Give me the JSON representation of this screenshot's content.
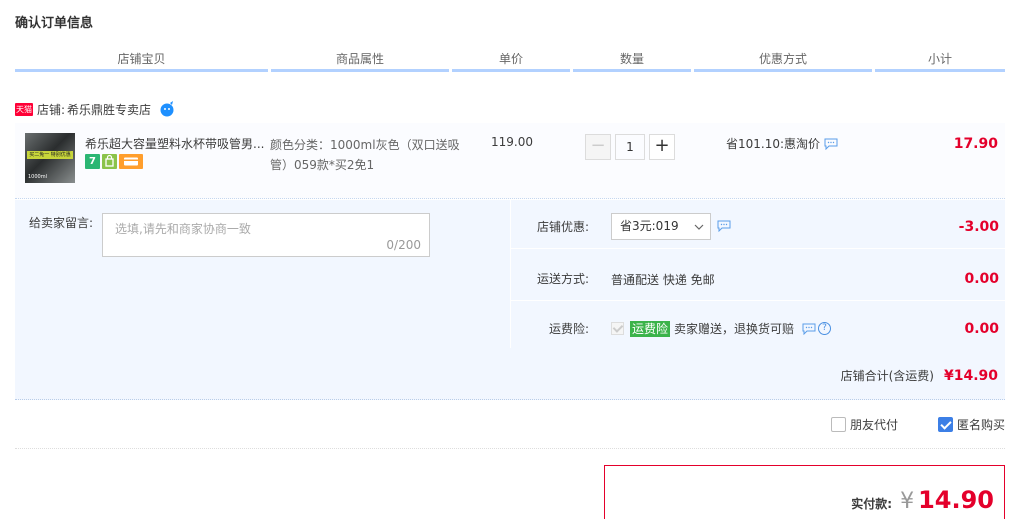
{
  "page": {
    "title": "确认订单信息"
  },
  "columns": [
    "店铺宝贝",
    "商品属性",
    "单价",
    "数量",
    "优惠方式",
    "小计"
  ],
  "shop": {
    "badge": "天猫",
    "label": "店铺:",
    "name": "希乐鼎胜专卖店"
  },
  "item": {
    "name": "希乐超大容量塑料水杯带吸管男...",
    "thumb_text": "买二免一 特别优惠",
    "thumb_sub": "1000ml",
    "attr": "颜色分类：1000ml灰色（双口送吸管）059款*买2免1",
    "price": "119.00",
    "qty": "1",
    "qty_minus": "−",
    "qty_plus": "+",
    "discount": "省101.10:惠淘价",
    "subtotal": "17.90",
    "badge7": "7"
  },
  "memo": {
    "label": "给卖家留言:",
    "placeholder": "选填,请先和商家协商一致",
    "count": "0/200"
  },
  "shop_discount": {
    "label": "店铺优惠:",
    "selected": "省3元:019",
    "amount": "-3.00"
  },
  "shipping": {
    "label": "运送方式:",
    "value": "普通配送 快递 免邮",
    "amount": "0.00"
  },
  "insurance": {
    "label": "运费险:",
    "tag": "运费险",
    "text": "卖家赠送，退换货可赔",
    "help": "?",
    "amount": "0.00"
  },
  "shop_total": {
    "label": "店铺合计(含运费)",
    "value": "¥14.90"
  },
  "options": {
    "friend_pay": "朋友代付",
    "anonymous": "匿名购买",
    "anonymous_checked": true,
    "friend_pay_checked": false
  },
  "payment": {
    "label": "实付款:",
    "currency": "¥",
    "value": "14.90"
  },
  "colors": {
    "accent_red": "#e4002b",
    "header_line": "#b2d1ff",
    "panel_bg": "#f2f7ff"
  }
}
